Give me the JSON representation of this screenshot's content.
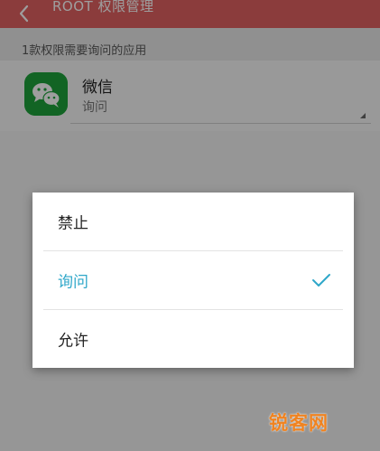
{
  "app_bar": {
    "title": "ROOT 权限管理",
    "back_icon": "chevron-left-icon",
    "background_color": "#e06262"
  },
  "section": {
    "header": "1款权限需要询问的应用"
  },
  "app_item": {
    "name": "微信",
    "permission": "询问",
    "icon": "wechat-icon",
    "icon_color": "#1da23a"
  },
  "dialog": {
    "options": [
      {
        "label": "禁止",
        "selected": false
      },
      {
        "label": "询问",
        "selected": true
      },
      {
        "label": "允许",
        "selected": false
      }
    ],
    "selected_color": "#2ea7c9",
    "check_icon": "checkmark-icon"
  },
  "watermark": {
    "text": "锐客网",
    "color": "#f08320"
  }
}
